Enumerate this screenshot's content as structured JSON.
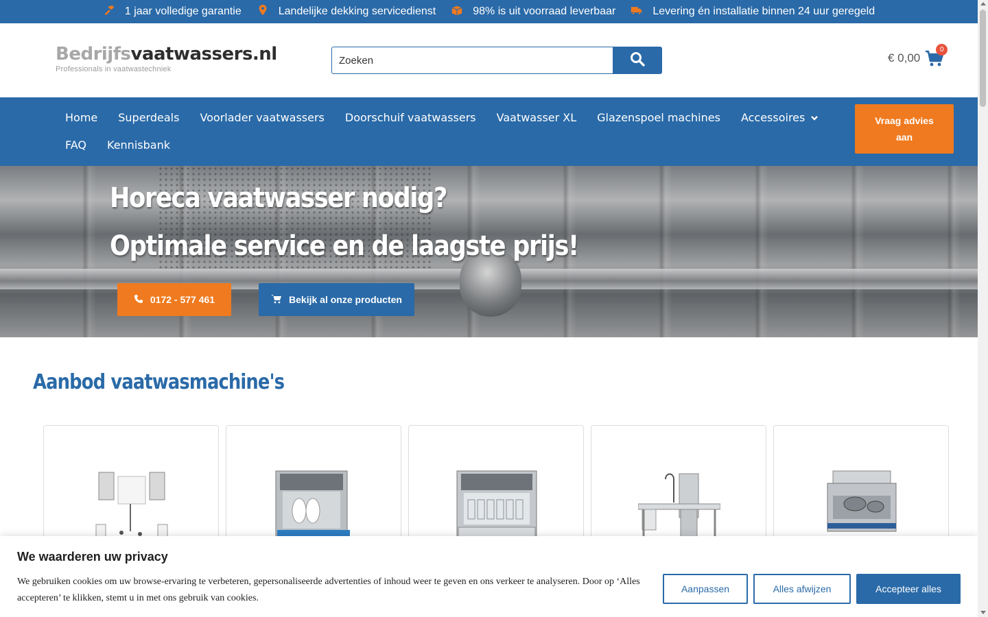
{
  "topbar": {
    "usps": [
      {
        "icon": "hammer-icon",
        "text": "1 jaar volledige garantie"
      },
      {
        "icon": "map-marker-icon",
        "text": "Landelijke dekking servicedienst"
      },
      {
        "icon": "box-icon",
        "text": "98% is uit voorraad leverbaar"
      },
      {
        "icon": "truck-icon",
        "text": "Levering én installatie binnen 24 uur geregeld"
      }
    ]
  },
  "header": {
    "logo_brand_light": "Bedrijfs",
    "logo_brand_dark": "vaatwassers.nl",
    "logo_tagline": "Professionals in vaatwastechniek",
    "search_placeholder": "Zoeken",
    "cart_amount": "€ 0,00",
    "cart_count": "0"
  },
  "nav": {
    "items": [
      "Home",
      "Superdeals",
      "Voorlader vaatwassers",
      "Doorschuif vaatwassers",
      "Vaatwasser XL",
      "Glazenspoel machines",
      "Accessoires",
      "FAQ",
      "Kennisbank"
    ],
    "advice_button": "Vraag advies aan"
  },
  "hero": {
    "headline_1": "Horeca vaatwasser nodig?",
    "headline_2": "Optimale service en de laagste prijs!",
    "phone_button": "0172 - 577 461",
    "products_button": "Bekijk al onze producten"
  },
  "section": {
    "title": "Aanbod vaatwasmachine's"
  },
  "cookie": {
    "title": "We waarderen uw privacy",
    "text": "We gebruiken cookies om uw browse-ervaring te verbeteren, gepersonaliseerde advertenties of inhoud weer te geven en ons verkeer te analyseren. Door op ‘Alles accepteren’ te klikken, stemt u in met ons gebruik van cookies.",
    "customize": "Aanpassen",
    "reject": "Alles afwijzen",
    "accept": "Accepteer alles"
  },
  "colors": {
    "brand_blue": "#2a6aa8",
    "accent_orange": "#f07a1f",
    "badge_red": "#e8533d"
  }
}
